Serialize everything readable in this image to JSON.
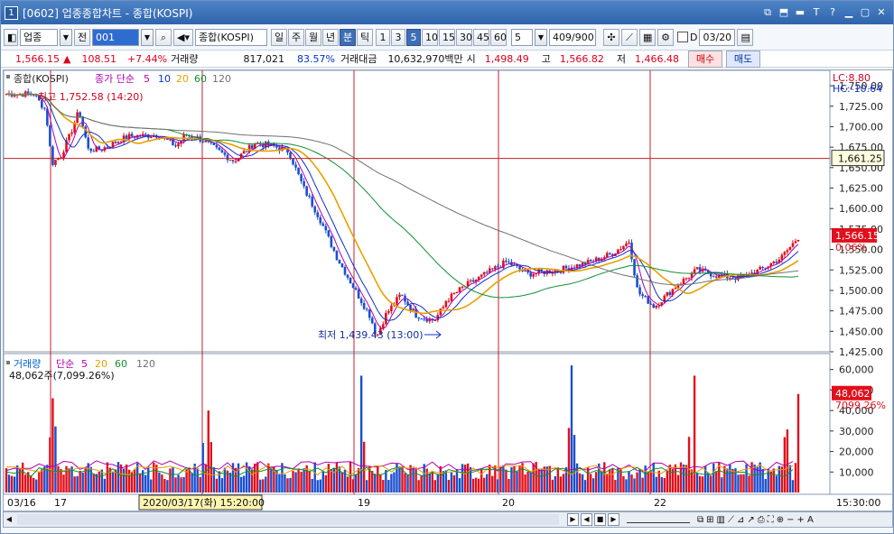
{
  "window": {
    "number": "1",
    "title": "[0602] 업종종합차트 - 종합(KOSPI)",
    "title_icons": [
      "⧉",
      "⬒",
      "▬",
      "T",
      "?",
      "▁",
      "▢",
      "✕"
    ]
  },
  "toolbar": {
    "market_type": "업종",
    "prev_label": "전",
    "code": "001",
    "index_name": "종합(KOSPI)",
    "periods": [
      "일",
      "주",
      "월",
      "년",
      "분",
      "틱",
      "1",
      "3",
      "5",
      "10",
      "15",
      "30",
      "45",
      "60"
    ],
    "active_period": "분",
    "active_interval": "5",
    "interval_value": "5",
    "count": "409/900",
    "checkbox_label": "D",
    "date": "03/20"
  },
  "quote": {
    "price": "1,566.15",
    "change_arrow": "▲",
    "change": "108.51",
    "change_pct": "+7.44%",
    "volume_label": "거래량",
    "volume": "817,021",
    "volume_ratio": "83.57%",
    "amount_label": "거래대금",
    "amount": "10,632,970백만",
    "open_label": "시",
    "open": "1,498.49",
    "high_label": "고",
    "high": "1,566.82",
    "low_label": "저",
    "low": "1,466.48",
    "buy_label": "매수",
    "sell_label": "매도"
  },
  "price_pane": {
    "legend_name": "종합(KOSPI)",
    "legend_ma": "종가 단순",
    "ma_periods": [
      "5",
      "10",
      "20",
      "60",
      "120"
    ],
    "lc": "LC:8.80",
    "hc": "HC:-10.64",
    "high_annotation": "최고 1,752.58 (14:20)",
    "low_annotation": "최저 1,439.43 (13:00)",
    "crosshair_label": "1,661.25",
    "last_price_label": "1,566.15",
    "last_pct_label": "0.06%",
    "yticks": [
      "1,750.00",
      "1,725.00",
      "1,700.00",
      "1,675.00",
      "1,650.00",
      "1,625.00",
      "1,600.00",
      "1,575.00",
      "1,550.00",
      "1,525.00",
      "1,500.00",
      "1,475.00",
      "1,450.00",
      "1,425.00"
    ]
  },
  "volume_pane": {
    "legend_name": "거래량",
    "legend_ma": "단순",
    "ma_periods": [
      "5",
      "20",
      "60",
      "120"
    ],
    "legend_value": "48,062주(7,099.26%)",
    "last_volume_label": "48,062",
    "last_pct_label": "7099.26%",
    "yticks": [
      "60,000",
      "50,000",
      "40,000",
      "30,000",
      "20,000",
      "10,000"
    ]
  },
  "xaxis": {
    "labels": [
      "03/16",
      "17",
      "19",
      "20",
      "22"
    ],
    "cursor_label": "2020/03/17(화) 15:20:00",
    "time_label": "15:30:00"
  },
  "colors": {
    "up": "#e0101c",
    "down": "#1a4fd0",
    "ma5": "#b000b0",
    "ma10": "#1030c0",
    "ma20": "#e8a000",
    "ma60": "#109030",
    "ma120": "#707070",
    "session_line": "#c02030",
    "crosshair": "#c02020"
  }
}
